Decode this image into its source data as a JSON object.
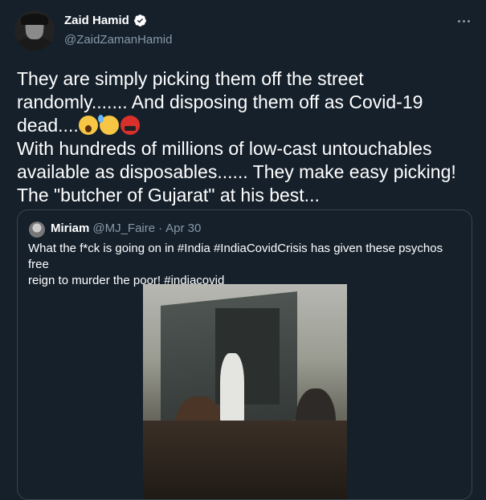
{
  "author": {
    "display_name": "Zaid Hamid",
    "handle": "@ZaidZamanHamid",
    "verified": true,
    "avatar_icon": "avatar-photo"
  },
  "tweet": {
    "line1": "They are simply picking them off the street",
    "line2": "randomly....... And disposing them off as Covid-19",
    "line3": "dead....",
    "emojis": [
      "face-screaming-in-fear",
      "anxious-face-with-sweat",
      "face-with-symbols-on-mouth"
    ],
    "line4": "With hundreds of millions of low-cast untouchables",
    "line5": "available as disposables...... They make easy picking!",
    "line6": "The \"butcher of Gujarat\" at his best..."
  },
  "quoted_tweet": {
    "display_name": "Miriam",
    "handle": "@MJ_Faire",
    "separator": "·",
    "date": "Apr 30",
    "text_line1": "What the f*ck is going on in #India #IndiaCovidCrisis has given these psychos free",
    "text_line2": "reign to murder the poor! #indiacovid",
    "media": "video-thumbnail"
  },
  "colors": {
    "background": "#15202b",
    "secondary_text": "#8899a6",
    "border": "#38444d",
    "verified": "#ffffff"
  }
}
